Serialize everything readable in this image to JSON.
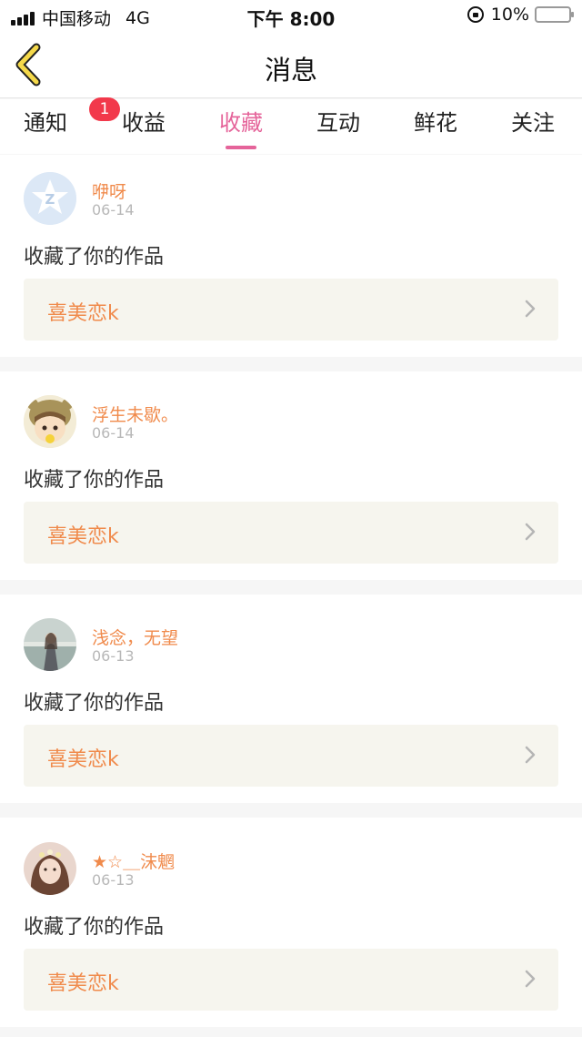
{
  "status_bar": {
    "carrier": "中国移动",
    "network": "4G",
    "time": "下午 8:00",
    "battery": "10%",
    "battery_level": 0.1
  },
  "nav": {
    "title": "消息",
    "back_icon": "back-chevron-icon"
  },
  "tabs": [
    {
      "label": "通知",
      "badge": "1"
    },
    {
      "label": "收益"
    },
    {
      "label": "收藏",
      "active": true
    },
    {
      "label": "互动"
    },
    {
      "label": "鲜花"
    },
    {
      "label": "关注"
    }
  ],
  "colors": {
    "accent": "#e5649a",
    "name": "#f08a4b",
    "badge": "#f2394b",
    "battery": "#f2c91e"
  },
  "messages": [
    {
      "name": "咿呀",
      "date": "06-14",
      "text": "收藏了你的作品",
      "work": "喜美恋k",
      "avatar": "default-star-avatar"
    },
    {
      "name": "浮生未歇。",
      "date": "06-14",
      "text": "收藏了你的作品",
      "work": "喜美恋k",
      "avatar": "cartoon-bear-hat-avatar"
    },
    {
      "name": "浅念，无望",
      "date": "06-13",
      "text": "收藏了你的作品",
      "work": "喜美恋k",
      "avatar": "seaside-girl-photo-avatar"
    },
    {
      "name": "★☆＿沫魍",
      "date": "06-13",
      "text": "收藏了你的作品",
      "work": "喜美恋k",
      "avatar": "girl-flower-crown-photo-avatar"
    }
  ]
}
